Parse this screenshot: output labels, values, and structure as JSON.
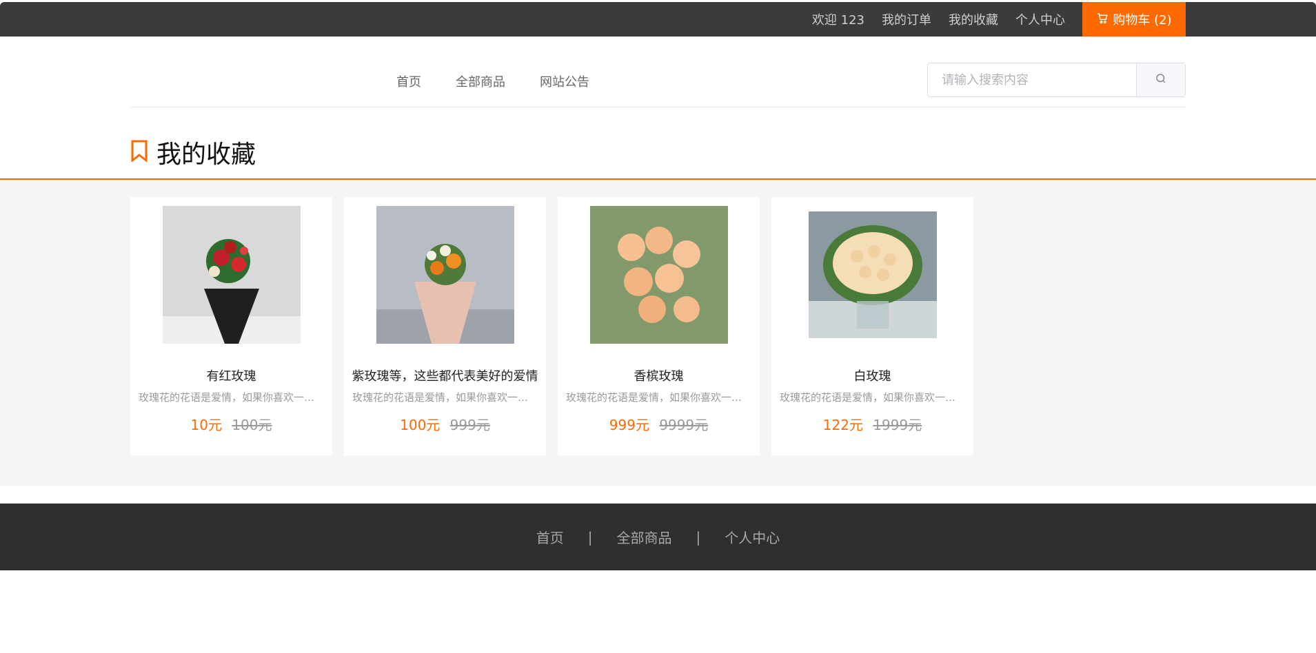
{
  "topbar": {
    "welcome": "欢迎 123",
    "orders": "我的订单",
    "favorites": "我的收藏",
    "profile": "个人中心",
    "cart": "购物车 (2)"
  },
  "nav": {
    "items": [
      "首页",
      "全部商品",
      "网站公告"
    ]
  },
  "search": {
    "placeholder": "请输入搜索内容"
  },
  "page": {
    "title": "我的收藏"
  },
  "favorites": [
    {
      "name": "有红玫瑰",
      "desc": "玫瑰花的花语是爱情，如果你喜欢一个...",
      "price": "10元",
      "old_price": "100元"
    },
    {
      "name": "紫玫瑰等，这些都代表美好的爱情",
      "desc": "玫瑰花的花语是爱情，如果你喜欢一个...",
      "price": "100元",
      "old_price": "999元"
    },
    {
      "name": "香槟玫瑰",
      "desc": "玫瑰花的花语是爱情，如果你喜欢一个...",
      "price": "999元",
      "old_price": "9999元"
    },
    {
      "name": "白玫瑰",
      "desc": "玫瑰花的花语是爱情，如果你喜欢一个...",
      "price": "122元",
      "old_price": "1999元"
    }
  ],
  "footer": {
    "links": [
      "首页",
      "全部商品",
      "个人中心"
    ],
    "separator": "|"
  },
  "colors": {
    "accent": "#ff6a00",
    "topbar": "#3b3b3b",
    "footer": "#2f2f2f",
    "content_bg": "#f5f5f5"
  }
}
